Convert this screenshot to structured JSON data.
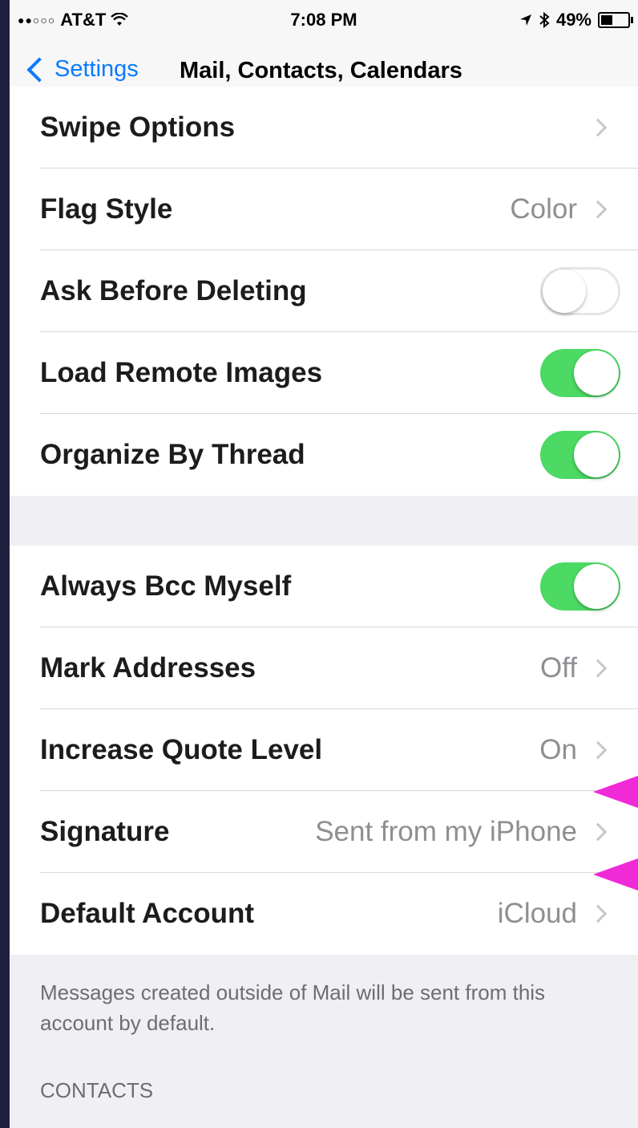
{
  "status_bar": {
    "signal_dots": "●●○○○",
    "carrier": "AT&T",
    "wifi_icon": "wifi-icon",
    "time": "7:08 PM",
    "location_icon": "location-arrow-icon",
    "bluetooth_icon": "bluetooth-icon",
    "battery": "49%",
    "battery_level": 0.49
  },
  "nav": {
    "back_label": "Settings",
    "title": "Mail, Contacts, Calendars"
  },
  "group1": {
    "swipe_options": "Swipe Options",
    "flag_style": "Flag Style",
    "flag_style_value": "Color",
    "ask_before_deleting": "Ask Before Deleting",
    "ask_before_deleting_on": false,
    "load_remote_images": "Load Remote Images",
    "load_remote_images_on": true,
    "organize_by_thread": "Organize By Thread",
    "organize_by_thread_on": true
  },
  "group2": {
    "always_bcc": "Always Bcc Myself",
    "always_bcc_on": true,
    "mark_addresses": "Mark Addresses",
    "mark_addresses_value": "Off",
    "increase_quote": "Increase Quote Level",
    "increase_quote_value": "On",
    "signature": "Signature",
    "signature_value": "Sent from my iPhone",
    "default_account": "Default Account",
    "default_account_value": "iCloud"
  },
  "footer_note": "Messages created outside of Mail will be sent from this account by default.",
  "contacts_header": "CONTACTS",
  "colors": {
    "accent": "#0a7aff",
    "toggle_on": "#4cd964",
    "annotation_arrow": "#f02ad6"
  }
}
